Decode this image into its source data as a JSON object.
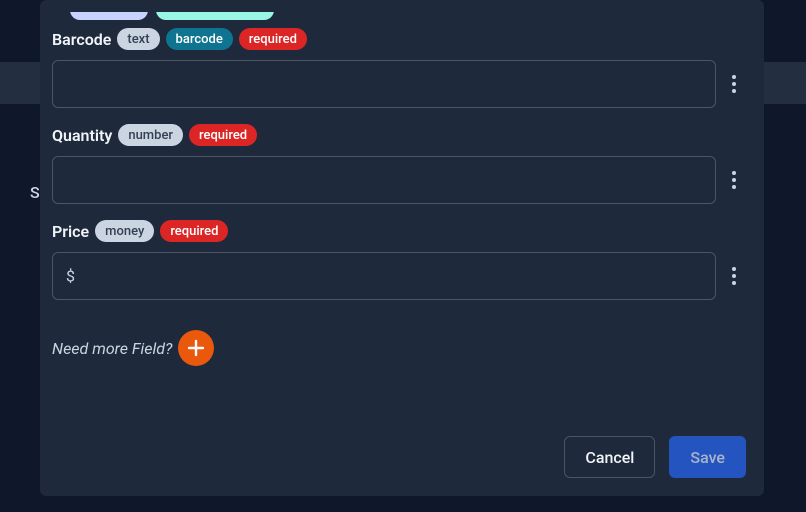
{
  "background": {
    "letter": "S"
  },
  "fields": [
    {
      "label": "Barcode",
      "type_chip": "text",
      "extra_chip": "barcode",
      "required_chip": "required",
      "value": "",
      "currency": null
    },
    {
      "label": "Quantity",
      "type_chip": "number",
      "extra_chip": null,
      "required_chip": "required",
      "value": "",
      "currency": null
    },
    {
      "label": "Price",
      "type_chip": "money",
      "extra_chip": null,
      "required_chip": "required",
      "value": "",
      "currency": "$"
    }
  ],
  "more_prompt": "Need more Field?",
  "footer": {
    "cancel": "Cancel",
    "save": "Save"
  }
}
